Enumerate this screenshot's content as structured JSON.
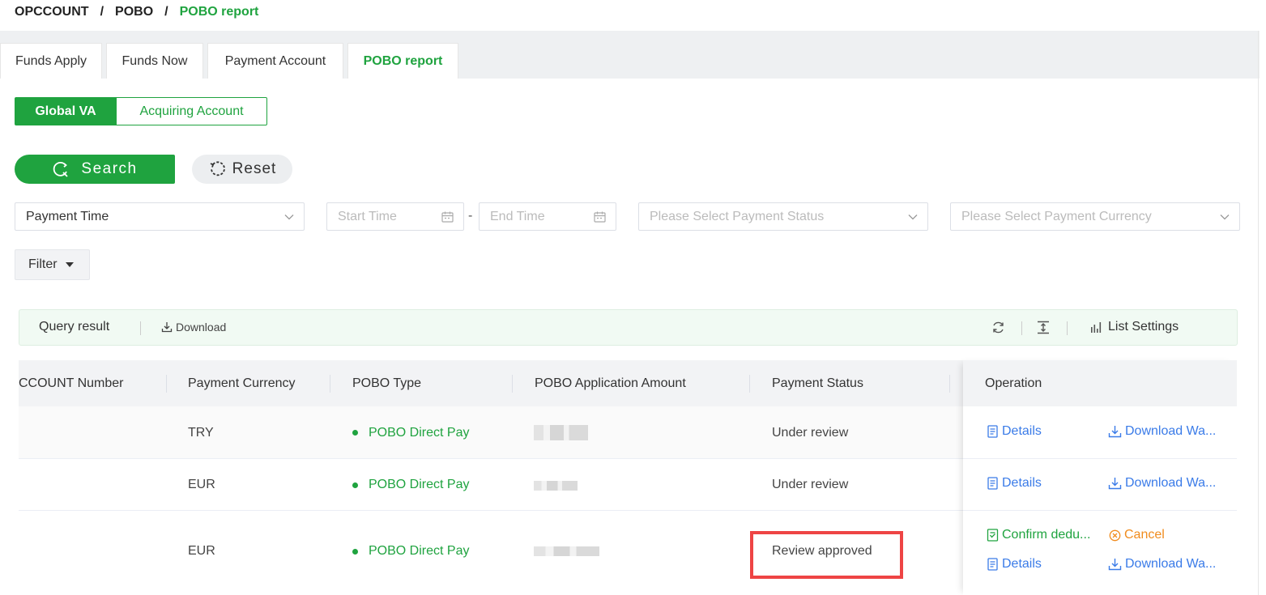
{
  "breadcrumb": {
    "level1": "OPCCOUNT",
    "level2": "POBO",
    "current": "POBO report",
    "separator": "/"
  },
  "tabs": [
    {
      "label": "Funds Apply",
      "active": false
    },
    {
      "label": "Funds Now",
      "active": false
    },
    {
      "label": "Payment Account",
      "active": false
    },
    {
      "label": "POBO report",
      "active": true
    }
  ],
  "segment": {
    "selected": "Global VA",
    "other": "Acquiring Account"
  },
  "actions": {
    "search": "Search",
    "reset": "Reset"
  },
  "filters": {
    "time_type": "Payment Time",
    "start_placeholder": "Start Time",
    "range_separator": "-",
    "end_placeholder": "End Time",
    "status_placeholder": "Please Select Payment Status",
    "currency_placeholder": "Please Select Payment Currency",
    "filter_label": "Filter"
  },
  "query_bar": {
    "title": "Query result",
    "download": "Download",
    "list_settings": "List Settings"
  },
  "table": {
    "columns": [
      "CCOUNT Number",
      "Payment Currency",
      "POBO Type",
      "POBO Application Amount",
      "Payment Status",
      "Operation"
    ],
    "rows": [
      {
        "currency": "TRY",
        "type": "POBO Direct Pay",
        "status": "Under review"
      },
      {
        "currency": "EUR",
        "type": "POBO Direct Pay",
        "status": "Under review"
      },
      {
        "currency": "EUR",
        "type": "POBO Direct Pay",
        "status": "Review approved"
      }
    ],
    "ops": {
      "details": "Details",
      "download": "Download Wa...",
      "confirm": "Confirm dedu...",
      "cancel": "Cancel"
    }
  },
  "colors": {
    "brand_green": "#1fa33f",
    "link_blue": "#3a7be8",
    "cancel_orange": "#f08c1e",
    "highlight_red": "#ee4444"
  }
}
